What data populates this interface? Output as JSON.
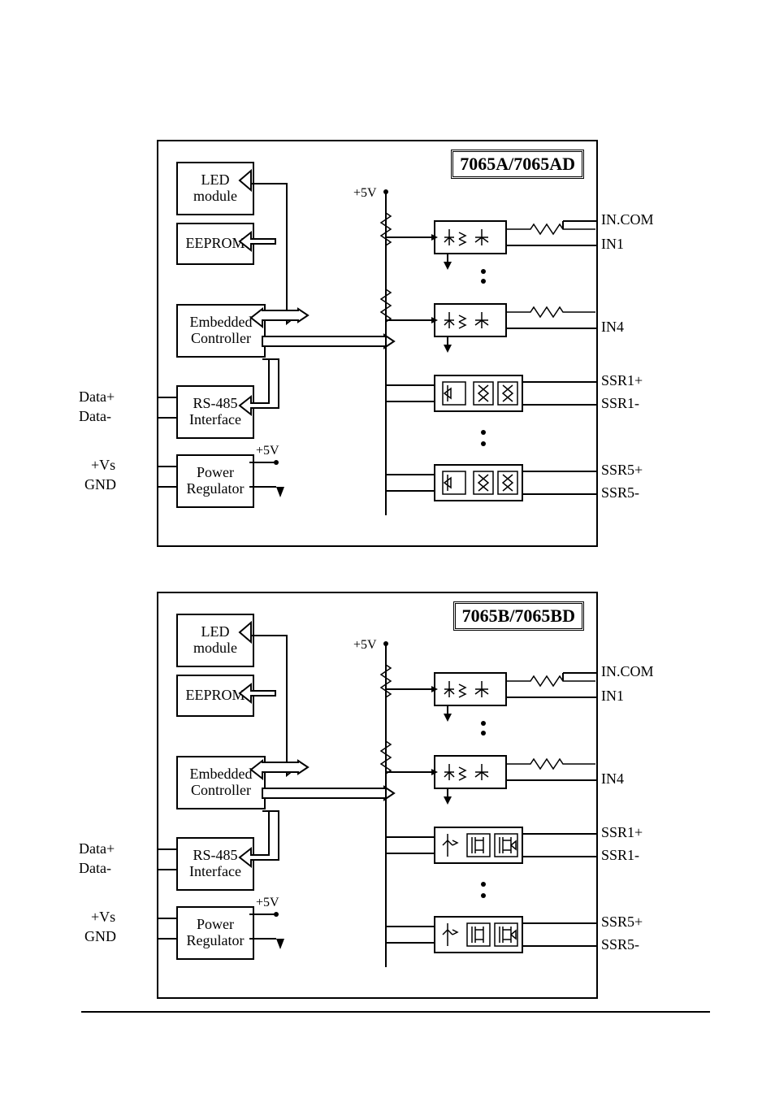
{
  "diagrams": [
    {
      "title": "7065A/7065AD",
      "blocks": {
        "led": "LED\nmodule",
        "eeprom": "EEPROM",
        "mcu": "Embedded\nController",
        "rs485": "RS-485\nInterface",
        "power": "Power\nRegulator"
      },
      "power_out": "+5V",
      "supply": "+5V",
      "pins_right": [
        "IN.COM",
        "IN1",
        "IN4",
        "SSR1+",
        "SSR1-",
        "SSR5+",
        "SSR5-"
      ],
      "pins_left": [
        "Data+",
        "Data-",
        "+Vs",
        "GND"
      ],
      "ssr_type": "A"
    },
    {
      "title": "7065B/7065BD",
      "blocks": {
        "led": "LED\nmodule",
        "eeprom": "EEPROM",
        "mcu": "Embedded\nController",
        "rs485": "RS-485\nInterface",
        "power": "Power\nRegulator"
      },
      "power_out": "+5V",
      "supply": "+5V",
      "pins_right": [
        "IN.COM",
        "IN1",
        "IN4",
        "SSR1+",
        "SSR1-",
        "SSR5+",
        "SSR5-"
      ],
      "pins_left": [
        "Data+",
        "Data-",
        "+Vs",
        "GND"
      ],
      "ssr_type": "B"
    }
  ]
}
